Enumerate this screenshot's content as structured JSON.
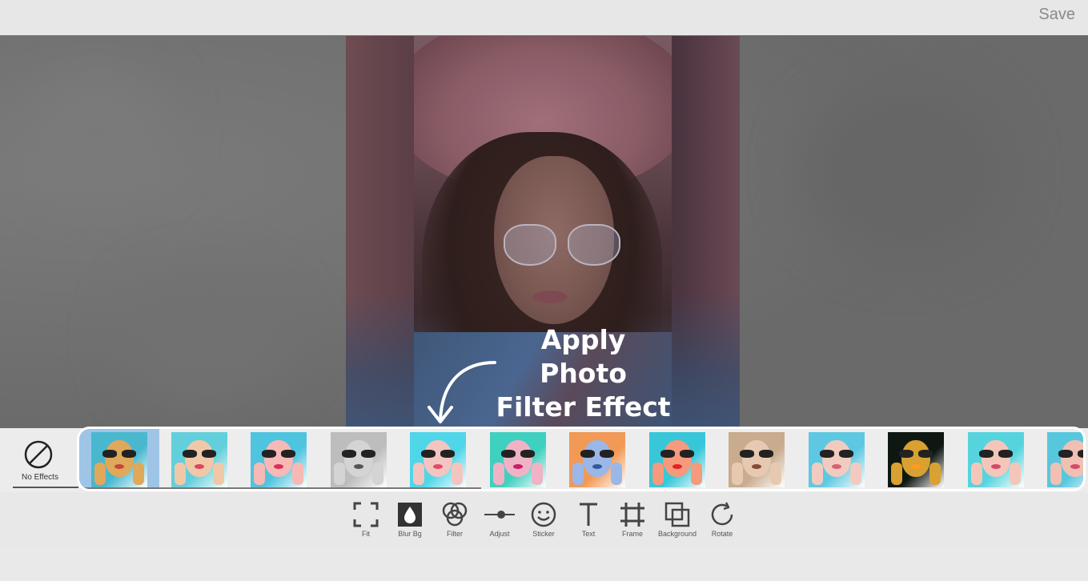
{
  "header": {
    "save_label": "Save"
  },
  "caption": {
    "line1": "Apply Photo",
    "line2": "Filter Effect"
  },
  "effects": {
    "no_effects_label": "No Effects",
    "thumbnails": [
      {
        "name": "filter-1",
        "bg": "#49b8cf",
        "skin": "#e0a85a",
        "lips": "#c5483c",
        "selected": true
      },
      {
        "name": "filter-2",
        "bg": "#63cfdc",
        "skin": "#f0c8a8",
        "lips": "#d8475e"
      },
      {
        "name": "filter-3",
        "bg": "#4fc4df",
        "skin": "#f6b9b5",
        "lips": "#dd2f55"
      },
      {
        "name": "filter-4",
        "bg": "#bdbdbd",
        "skin": "#d4d4d4",
        "lips": "#555555"
      },
      {
        "name": "filter-5",
        "bg": "#4fd6e8",
        "skin": "#f3c5c0",
        "lips": "#e54a6a"
      },
      {
        "name": "filter-6",
        "bg": "#3fd0c0",
        "skin": "#f0b3c6",
        "lips": "#c71e6c"
      },
      {
        "name": "filter-7",
        "bg": "#f29955",
        "skin": "#9ab7e8",
        "lips": "#315b9e"
      },
      {
        "name": "filter-8",
        "bg": "#37c7d9",
        "skin": "#f59a7c",
        "lips": "#e5221f"
      },
      {
        "name": "filter-9",
        "bg": "#c9ab8d",
        "skin": "#e7c9b2",
        "lips": "#8a4a34"
      },
      {
        "name": "filter-10",
        "bg": "#5ec8e2",
        "skin": "#f1cbc0",
        "lips": "#d76075"
      },
      {
        "name": "filter-11",
        "bg": "#0f1712",
        "skin": "#d8a131",
        "lips": "#ff9b1e"
      },
      {
        "name": "filter-12",
        "bg": "#55d4de",
        "skin": "#f4c6b9",
        "lips": "#d8466b"
      },
      {
        "name": "filter-13",
        "bg": "#57c7de",
        "skin": "#efc0b3",
        "lips": "#d64a66"
      }
    ]
  },
  "toolbar": {
    "tools": [
      {
        "name": "fit",
        "label": "Fit"
      },
      {
        "name": "blur-bg",
        "label": "Blur Bg"
      },
      {
        "name": "filter",
        "label": "Filter"
      },
      {
        "name": "adjust",
        "label": "Adjust"
      },
      {
        "name": "sticker",
        "label": "Sticker"
      },
      {
        "name": "text",
        "label": "Text"
      },
      {
        "name": "frame",
        "label": "Frame"
      },
      {
        "name": "background",
        "label": "Background"
      },
      {
        "name": "rotate",
        "label": "Rotate"
      }
    ]
  }
}
